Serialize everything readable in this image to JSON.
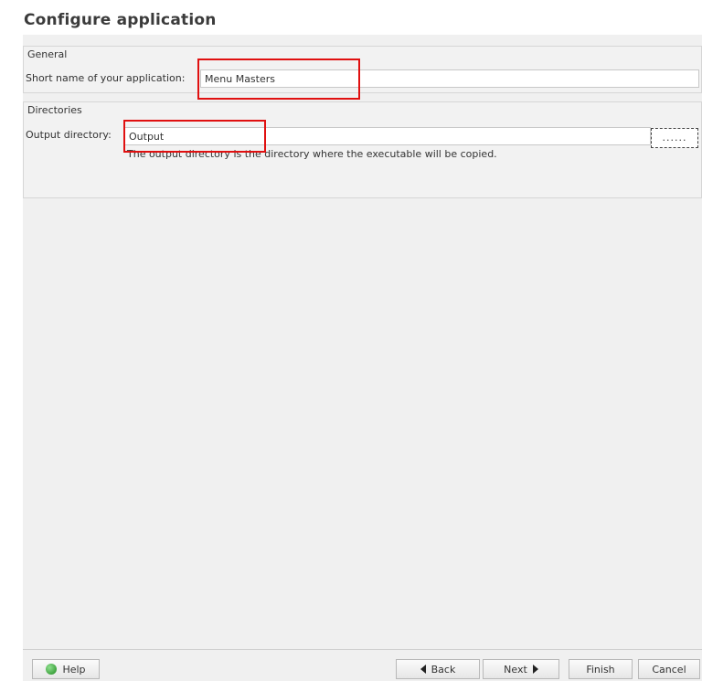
{
  "header": {
    "title": "Configure application"
  },
  "general": {
    "group_title": "General",
    "short_name_label": "Short name of your application:",
    "short_name_value": "Menu Masters"
  },
  "directories": {
    "group_title": "Directories",
    "output_dir_label": "Output directory:",
    "output_dir_value": "Output",
    "browse_label": "......",
    "hint": "The output directory is the directory where the executable will be copied."
  },
  "footer": {
    "help_label": "Help",
    "back_label": "Back",
    "next_label": "Next",
    "finish_label": "Finish",
    "cancel_label": "Cancel"
  },
  "colors": {
    "highlight": "#e01010",
    "help_icon": "#1e8a1e"
  },
  "icons": {
    "help": "help-icon",
    "back": "arrow-left-icon",
    "next": "arrow-right-icon"
  }
}
